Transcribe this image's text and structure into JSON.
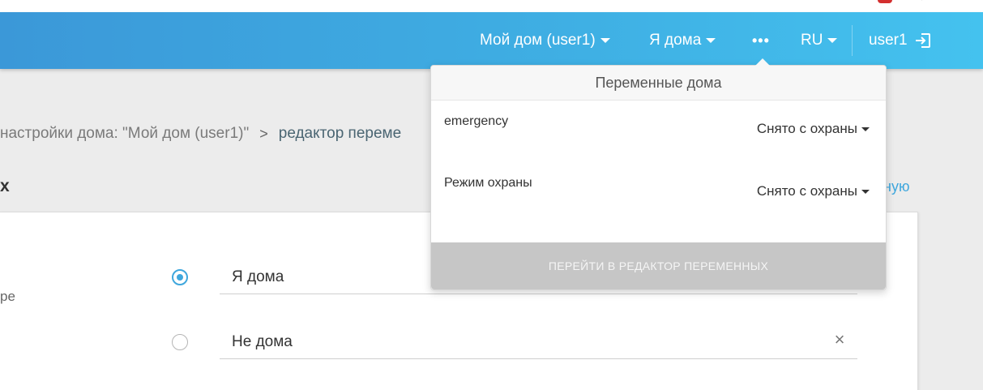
{
  "header": {
    "home_label": "Мой дом (user1)",
    "presence_label": "Я дома",
    "more_label": "•••",
    "language_label": "RU",
    "user_label": "user1"
  },
  "breadcrumb": {
    "parent": "настройки дома: \"Мой дом (user1)\"",
    "separator": ">",
    "current": "редактор переме"
  },
  "section": {
    "title": "х",
    "right_link": "ную"
  },
  "card": {
    "side_text": "ре",
    "modes": [
      {
        "label": "Я дома",
        "selected": true
      },
      {
        "label": "Не дома",
        "selected": false
      }
    ],
    "clear_glyph": "×"
  },
  "dropdown": {
    "title": "Переменные дома",
    "variables": [
      {
        "name": "emergency",
        "value": "Снято с охраны"
      },
      {
        "name": "Режим охраны",
        "value": "Снято с охраны"
      }
    ],
    "button_label": "ПЕРЕЙТИ В РЕДАКТОР ПЕРЕМЕННЫХ"
  },
  "colors": {
    "header_start": "#3b98d8",
    "header_end": "#44c2ef",
    "accent": "#3fa7dd",
    "disabled_button": "#c6c6c6"
  },
  "icons": {
    "logout": "logout-icon",
    "caret": "caret-down-icon",
    "clear": "close-icon"
  }
}
